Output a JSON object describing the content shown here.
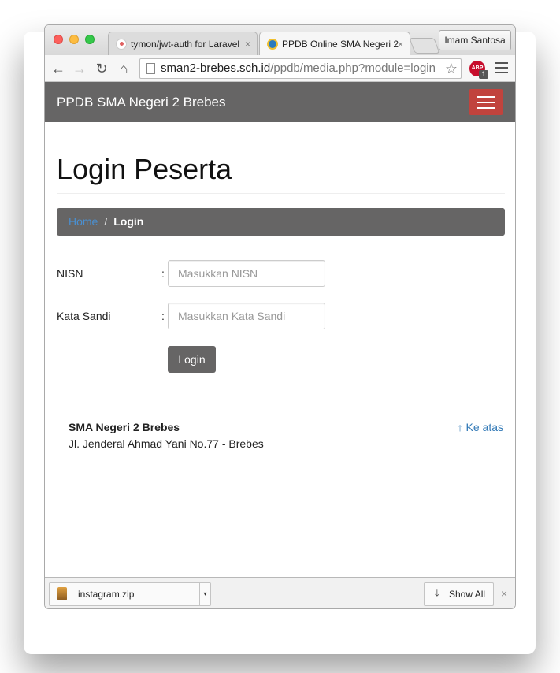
{
  "browser": {
    "tabs": [
      {
        "title": "tymon/jwt-auth for Laravel",
        "active": false
      },
      {
        "title": "PPDB Online SMA Negeri 2",
        "active": true
      }
    ],
    "profile": "Imam Santosa",
    "url_host": "sman2-brebes.sch.id",
    "url_path": "/ppdb/media.php?module=login",
    "abp_label": "ABP",
    "abp_count": "1"
  },
  "navbar": {
    "brand": "PPDB SMA Negeri 2 Brebes",
    "toggle_color": "#c1433d"
  },
  "page": {
    "title": "Login Peserta"
  },
  "breadcrumb": {
    "home": "Home",
    "separator": "/",
    "active": "Login"
  },
  "form": {
    "nisn_label": "NISN",
    "nisn_placeholder": "Masukkan NISN",
    "password_label": "Kata Sandi",
    "password_placeholder": "Masukkan Kata Sandi",
    "colon": ":",
    "submit": "Login"
  },
  "footer": {
    "school_name": "SMA Negeri 2 Brebes",
    "address": "Jl. Jenderal Ahmad Yani No.77 - Brebes",
    "back_to_top": "Ke atas"
  },
  "downloads": {
    "file_name": "instagram.zip",
    "show_all": "Show All"
  },
  "icons": {
    "tab_close": "×",
    "back": "←",
    "forward": "→",
    "reload": "↻",
    "home": "⌂",
    "star": "☆",
    "arrow_up": "↑",
    "download": "⤓",
    "close": "×",
    "caret": "▾"
  }
}
